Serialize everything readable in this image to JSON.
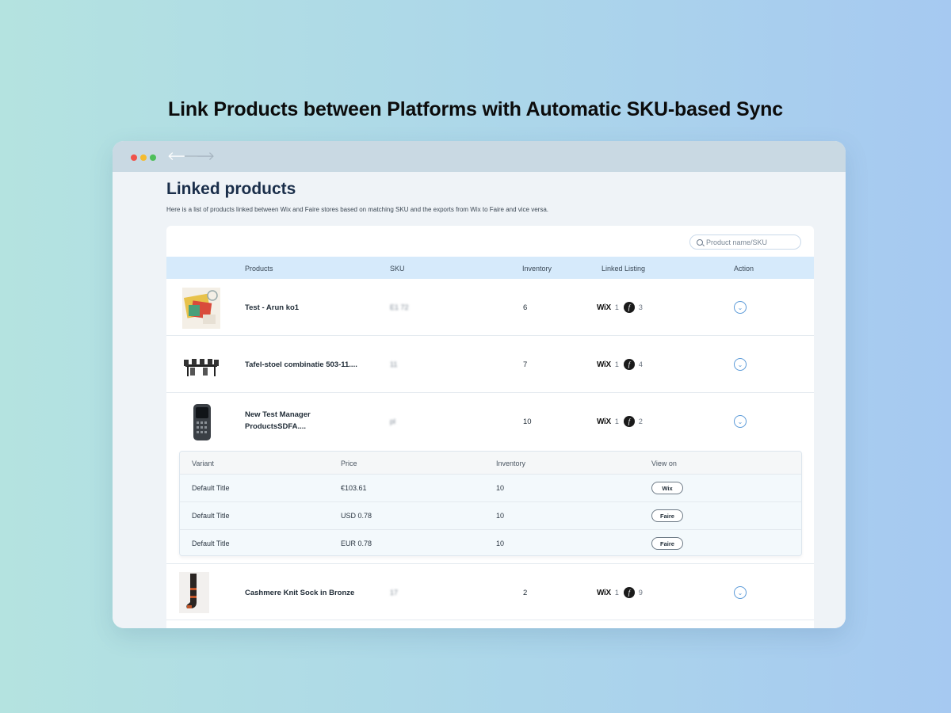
{
  "headline": "Link Products between Platforms with Automatic SKU-based Sync",
  "page": {
    "title": "Linked products",
    "description": "Here is a list of products linked between Wix and Faire stores based on matching SKU and the exports from Wix to Faire and vice versa."
  },
  "search": {
    "placeholder": "Product name/SKU"
  },
  "table": {
    "columns": [
      "Products",
      "SKU",
      "Inventory",
      "Linked Listing",
      "Action"
    ],
    "rows": [
      {
        "name": "Test - Arun ko1",
        "sku": "E1          72",
        "inventory": "6",
        "wix_label": "WiX",
        "wix_count": "1",
        "faire_count": "3"
      },
      {
        "name": "Tafel-stoel combinatie 503-11....",
        "sku": "11",
        "inventory": "7",
        "wix_label": "WiX",
        "wix_count": "1",
        "faire_count": "4"
      },
      {
        "name": "New Test Manager ProductsSDFA....",
        "sku": "pl",
        "inventory": "10",
        "wix_label": "WiX",
        "wix_count": "1",
        "faire_count": "2"
      },
      {
        "name": "Cashmere Knit Sock in Bronze",
        "sku": "17",
        "inventory": "2",
        "wix_label": "WiX",
        "wix_count": "1",
        "faire_count": "9"
      }
    ]
  },
  "variants": {
    "columns": [
      "Variant",
      "Price",
      "Inventory",
      "View on"
    ],
    "rows": [
      {
        "variant": "Default Title",
        "price": "€103.61",
        "inventory": "10",
        "view_on": "Wix"
      },
      {
        "variant": "Default Title",
        "price": "USD  0.78",
        "inventory": "10",
        "view_on": "Faire"
      },
      {
        "variant": "Default Title",
        "price": "EUR  0.78",
        "inventory": "10",
        "view_on": "Faire"
      }
    ]
  },
  "colors": {
    "accent": "#5b9ad8",
    "header_bg": "#d6eafb",
    "title": "#1a2e4a"
  },
  "icons": {
    "faire": "faire-icon",
    "action": "chevron-down-icon",
    "search": "search-icon"
  }
}
